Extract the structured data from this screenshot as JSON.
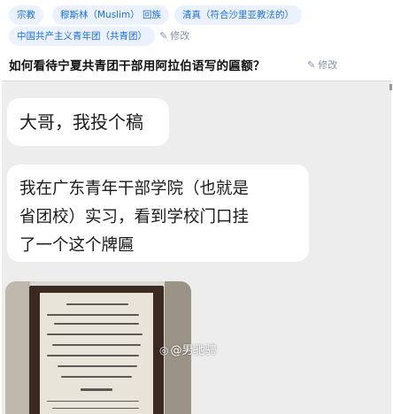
{
  "topics": [
    {
      "label": "宗教"
    },
    {
      "label": "穆斯林（Muslim）"
    },
    {
      "label": "回族"
    },
    {
      "label": "清真（符合沙里亚教法的）"
    },
    {
      "label": "中国共产主义青年团（共青团）"
    }
  ],
  "topics_edit_label": "修改",
  "question": {
    "title": "如何看待宁夏共青团干部用阿拉伯语写的匾额？",
    "edit_label": "修改"
  },
  "chat": {
    "messages": [
      {
        "text": "大哥，我投个稿"
      },
      {
        "line1": "我在广东青年干部学院（也就是",
        "line2": "省团校）实习，看到学校门口挂",
        "line3": "了一个这个牌匾"
      }
    ],
    "watermark": "@男驰骋"
  },
  "colors": {
    "tag_bg": "#ebf2fd",
    "tag_text": "#1a6fe0",
    "muted": "#8590a6",
    "chat_bg": "#ededed"
  }
}
